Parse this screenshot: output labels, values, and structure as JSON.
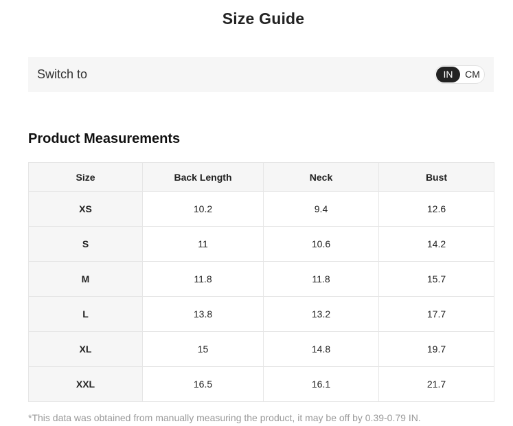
{
  "title": "Size Guide",
  "switch": {
    "label": "Switch to",
    "options": [
      "IN",
      "CM"
    ],
    "selected": "IN",
    "selected_color": "#222222"
  },
  "section_title": "Product Measurements",
  "table": {
    "headers": [
      "Size",
      "Back Length",
      "Neck",
      "Bust"
    ],
    "rows": [
      [
        "XS",
        "10.2",
        "9.4",
        "12.6"
      ],
      [
        "S",
        "11",
        "10.6",
        "14.2"
      ],
      [
        "M",
        "11.8",
        "11.8",
        "15.7"
      ],
      [
        "L",
        "13.8",
        "13.2",
        "17.7"
      ],
      [
        "XL",
        "15",
        "14.8",
        "19.7"
      ],
      [
        "XXL",
        "16.5",
        "16.1",
        "21.7"
      ]
    ]
  },
  "footnote": "*This data was obtained from manually measuring the product, it may be off by 0.39-0.79 IN."
}
